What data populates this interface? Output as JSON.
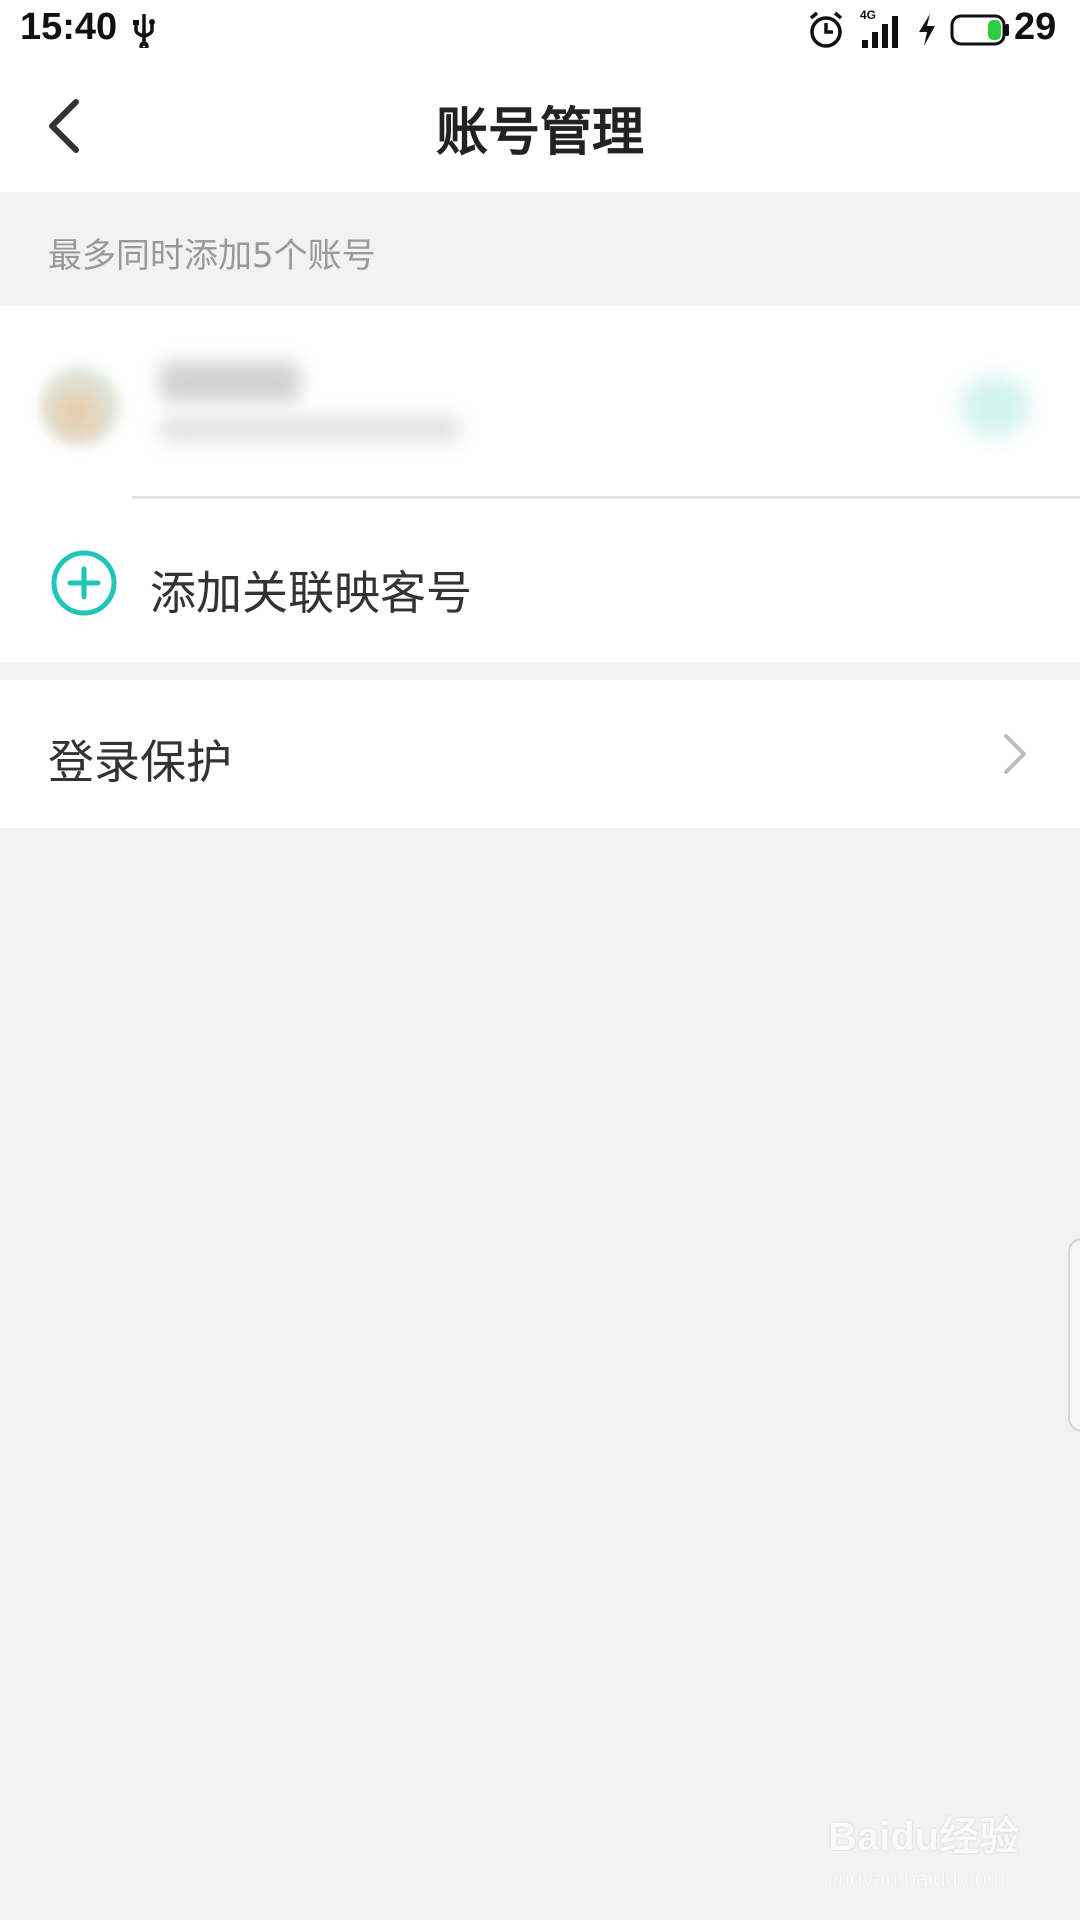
{
  "status_bar": {
    "time": "15:40",
    "network": "4G",
    "battery_level": "29",
    "icons": [
      "usb-icon",
      "alarm-icon",
      "signal-icon",
      "charging-bolt-icon",
      "battery-icon"
    ],
    "battery_color": "#2ecc40"
  },
  "header": {
    "title": "账号管理",
    "back_icon": "chevron-left-icon"
  },
  "hint": {
    "text": "最多同时添加5个账号"
  },
  "accounts": {
    "add_label": "添加关联映客号",
    "add_icon": "plus-circle-icon",
    "accent_color": "#1ec6b8"
  },
  "settings": {
    "login_protection_label": "登录保护",
    "chevron_icon": "chevron-right-icon"
  },
  "watermark": {
    "logo_text": "Baidu经验",
    "url_text": "jingyan.baidu.com"
  }
}
